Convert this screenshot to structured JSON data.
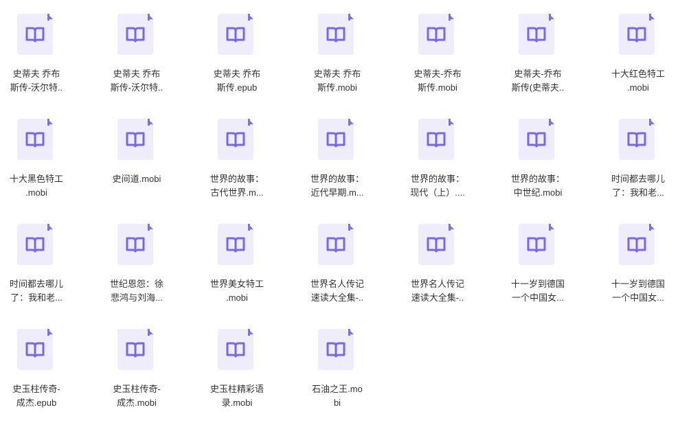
{
  "colors": {
    "doc_bg": "#efedfb",
    "doc_fold": "#7f6ee4",
    "book_icon": "#7b67df",
    "text": "#333333"
  },
  "files": [
    {
      "line1": "史蒂夫 乔布",
      "line2": "斯传-沃尔特.."
    },
    {
      "line1": "史蒂夫 乔布",
      "line2": "斯传-沃尔特.."
    },
    {
      "line1": "史蒂夫 乔布",
      "line2": "斯传.epub"
    },
    {
      "line1": "史蒂夫 乔布",
      "line2": "斯传.mobi"
    },
    {
      "line1": "史蒂夫-乔布",
      "line2": "斯传.mobi"
    },
    {
      "line1": "史蒂夫-乔布",
      "line2": "斯传(史蒂夫.."
    },
    {
      "line1": "十大红色特工",
      "line2": ".mobi"
    },
    {
      "line1": "十大黑色特工",
      "line2": ".mobi"
    },
    {
      "line1": "史间道.mobi",
      "line2": ""
    },
    {
      "line1": "世界的故事：",
      "line2": "古代世界.m..."
    },
    {
      "line1": "世界的故事：",
      "line2": "近代早期.m..."
    },
    {
      "line1": "世界的故事：",
      "line2": "现代（上）...."
    },
    {
      "line1": "世界的故事：",
      "line2": "中世纪.mobi"
    },
    {
      "line1": "时间都去哪儿",
      "line2": "了：我和老..."
    },
    {
      "line1": "时间都去哪儿",
      "line2": "了：我和老..."
    },
    {
      "line1": "世纪恩怨：徐",
      "line2": "悲鸿与刘海..."
    },
    {
      "line1": "世界美女特工",
      "line2": ".mobi"
    },
    {
      "line1": "世界名人传记",
      "line2": "速读大全集-.."
    },
    {
      "line1": "世界名人传记",
      "line2": "速读大全集-.."
    },
    {
      "line1": "十一岁到德国",
      "line2": "一个中国女..."
    },
    {
      "line1": "十一岁到德国",
      "line2": "一个中国女..."
    },
    {
      "line1": "史玉柱传奇-",
      "line2": "成杰.epub"
    },
    {
      "line1": "史玉柱传奇-",
      "line2": "成杰.mobi"
    },
    {
      "line1": "史玉柱精彩语",
      "line2": "录.mobi"
    },
    {
      "line1": "石油之王.mo",
      "line2": "bi"
    }
  ]
}
